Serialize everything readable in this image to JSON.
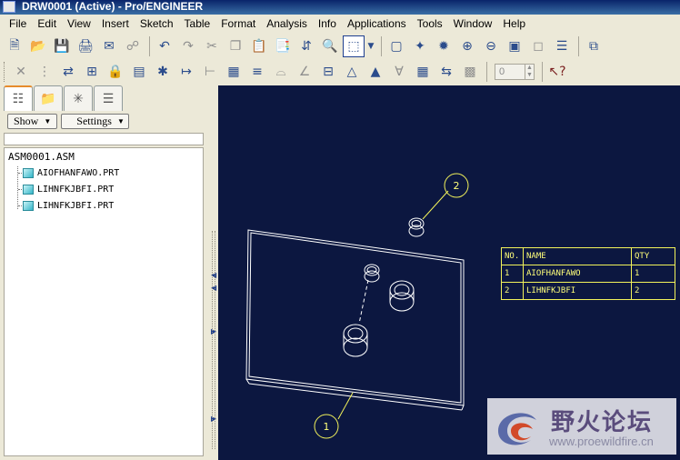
{
  "window": {
    "title": "DRW0001 (Active) - Pro/ENGINEER"
  },
  "menu": {
    "items": [
      "File",
      "Edit",
      "View",
      "Insert",
      "Sketch",
      "Table",
      "Format",
      "Analysis",
      "Info",
      "Applications",
      "Tools",
      "Window",
      "Help"
    ]
  },
  "toolbar2": {
    "zoom_value": "0"
  },
  "panel": {
    "show_label": "Show",
    "settings_label": "Settings",
    "tree": {
      "root": "ASM0001.ASM",
      "children": [
        "AIOFHANFAWO.PRT",
        "LIHNFKJBFI.PRT",
        "LIHNFKJBFI.PRT"
      ]
    }
  },
  "drawing": {
    "balloons": [
      "2",
      "1"
    ],
    "bom": {
      "headers": [
        "NO.",
        "NAME",
        "QTY"
      ],
      "rows": [
        [
          "1",
          "AIOFHANFAWO",
          "1"
        ],
        [
          "2",
          "LIHNFKJBFI",
          "2"
        ]
      ]
    }
  },
  "watermark": {
    "brand": "野火论坛",
    "url": "www.proewildfire.cn"
  },
  "colors": {
    "graphics_bg": "#0c1740",
    "bom_line": "#f2f25a",
    "model_line": "#ffffff",
    "title_bar": "#0a246a"
  }
}
